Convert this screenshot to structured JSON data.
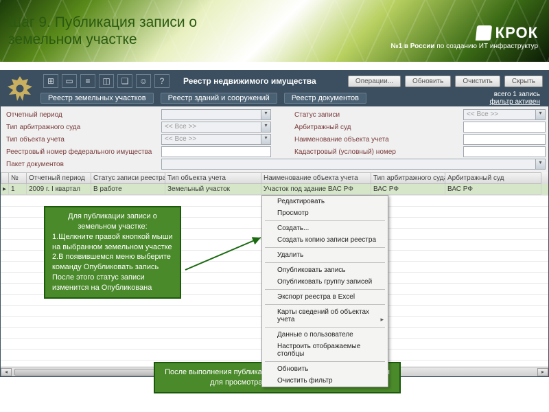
{
  "slide": {
    "title_l1": "Шаг 9. Публикация записи о",
    "title_l2": "земельном участке",
    "brand": "КРОК",
    "subline_lead": "№1 в России",
    "subline_rest": "по созданию ИТ инфраструктур"
  },
  "header": {
    "app_title": "Реестр недвижимого имущества",
    "buttons": {
      "ops": "Операции...",
      "refresh": "Обновить",
      "clear": "Очистить",
      "hide": "Скрыть"
    }
  },
  "tabs": {
    "land": "Реестр земельных участков",
    "buildings": "Реестр зданий и сооружений",
    "docs": "Реестр документов"
  },
  "status": {
    "count": "всего 1 запись",
    "filter": "фильтр активен"
  },
  "filters": {
    "l_period": "Отчетный период",
    "l_court_type": "Тип арбитражного суда",
    "l_obj_type": "Тип объекта учета",
    "l_fed_num": "Реестровый номер федерального имущества",
    "l_pack": "Пакет документов",
    "l_status": "Статус записи",
    "l_court": "Арбитражный суд",
    "l_obj_name": "Наименование объекта учета",
    "l_cadastral": "Кадастровый (условный) номер",
    "all": "<< Все >>"
  },
  "grid": {
    "cols": {
      "num": "№",
      "period": "Отчетный период",
      "status": "Статус записи реестра",
      "objtype": "Тип объекта учета",
      "objname": "Наименование объекта учета",
      "courttype": "Тип арбитражного суда",
      "court": "Арбитражный суд"
    },
    "row": {
      "marker": "▸",
      "num": "1",
      "period": "2009 г. I квартал",
      "status": "В работе",
      "objtype": "Земельный участок",
      "objname": "Участок под здание ВАС РФ",
      "courttype": "ВАС РФ",
      "court": "ВАС РФ"
    }
  },
  "context_menu": {
    "edit": "Редактировать",
    "view": "Просмотр",
    "create": "Создать...",
    "copy": "Создать копию записи реестра",
    "delete": "Удалить",
    "publish": "Опубликовать запись",
    "publish_group": "Опубликовать группу записей",
    "export": "Экспорт реестра в Excel",
    "cards": "Карты сведений об объектах учета",
    "user": "Данные о пользователе",
    "columns": "Настроить отображаемые столбцы",
    "refresh": "Обновить",
    "clear_filter": "Очистить фильтр"
  },
  "callouts": {
    "c1_title": "Для публикации записи о земельном участке:",
    "c1_p1": "1.Щелкните правой кнопкой мыши на выбранном земельном участке",
    "c1_p2": "2.В появившемся меню выберите команду Опубликовать запись",
    "c1_p3": "После этого статус записи изменится на Опубликована",
    "c2": "После выполнения публикации записи данные станут доступны для просмотра специалистам ВАС РФ"
  }
}
